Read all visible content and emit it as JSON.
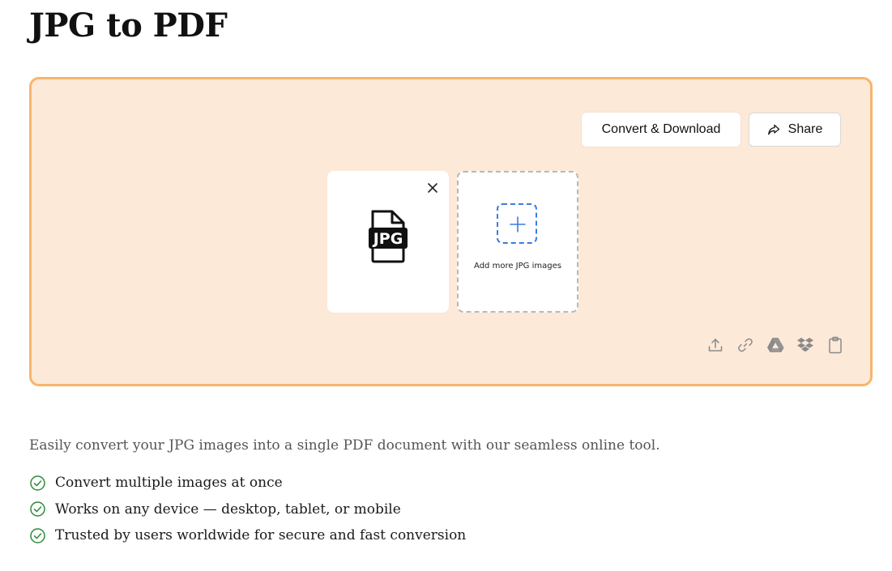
{
  "page": {
    "title": "JPG to PDF"
  },
  "toolbar": {
    "convert_label": "Convert & Download",
    "share_label": "Share"
  },
  "files": [
    {
      "icon": "jpg-file-icon",
      "type_label": "JPG"
    }
  ],
  "add_card": {
    "label": "Add more JPG images",
    "icon": "plus-icon"
  },
  "sources": [
    {
      "name": "upload-icon"
    },
    {
      "name": "link-icon"
    },
    {
      "name": "google-drive-icon"
    },
    {
      "name": "dropbox-icon"
    },
    {
      "name": "clipboard-icon"
    }
  ],
  "content": {
    "description": "Easily convert your JPG images into a single PDF document with our seamless online tool.",
    "features": [
      "Convert multiple images at once",
      "Works on any device — desktop, tablet, or mobile",
      "Trusted by users worldwide for secure and fast conversion"
    ]
  },
  "colors": {
    "panel_bg": "#fde9d8",
    "panel_border": "#f7b56c",
    "accent_blue": "#3b7be0",
    "check_green": "#2e8b3a"
  }
}
